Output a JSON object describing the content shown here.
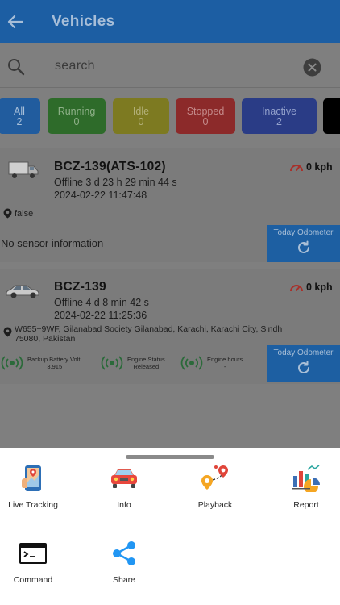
{
  "header": {
    "title": "Vehicles"
  },
  "search": {
    "placeholder": "search"
  },
  "filters": [
    {
      "label": "All",
      "count": "2",
      "bg": "#215c9e",
      "fg": "#a7bfd9"
    },
    {
      "label": "Running",
      "count": "0",
      "bg": "#2e6b2a",
      "fg": "#8fb189"
    },
    {
      "label": "Idle",
      "count": "0",
      "bg": "#7d7a21",
      "fg": "#b4b17a"
    },
    {
      "label": "Stopped",
      "count": "0",
      "bg": "#8c2a2a",
      "fg": "#c48a8a"
    },
    {
      "label": "Inactive",
      "count": "2",
      "bg": "#2a3c86",
      "fg": "#93a1cc"
    }
  ],
  "vehicles": [
    {
      "plate": "BCZ-139(ATS-102)",
      "status": "Offline 3 d 23 h 29 min 44 s",
      "datetime": "2024-02-22 11:47:48",
      "speed": "0 kph",
      "location": "false",
      "sensor_info": "No sensor information",
      "odometer_label": "Today Odometer"
    },
    {
      "plate": "BCZ-139",
      "status": "Offline 4 d 8 min 42 s",
      "datetime": "2024-02-22 11:25:36",
      "speed": "0 kph",
      "location": "W655+9WF, Gilanabad Society Gilanabad, Karachi, Karachi City, Sindh 75080, Pakistan",
      "sensors": [
        {
          "name": "Backup Battery Volt.",
          "value": "3.915"
        },
        {
          "name": "Engine Status",
          "value": "Released"
        },
        {
          "name": "Engine hours",
          "value": "-"
        }
      ],
      "odometer_label": "Today Odometer"
    }
  ],
  "actions": [
    {
      "label": "Live Tracking",
      "icon": "live-tracking-icon"
    },
    {
      "label": "Info",
      "icon": "car-info-icon"
    },
    {
      "label": "Playback",
      "icon": "playback-route-icon"
    },
    {
      "label": "Report",
      "icon": "report-chart-icon"
    },
    {
      "label": "Command",
      "icon": "terminal-command-icon"
    },
    {
      "label": "Share",
      "icon": "share-icon"
    }
  ]
}
